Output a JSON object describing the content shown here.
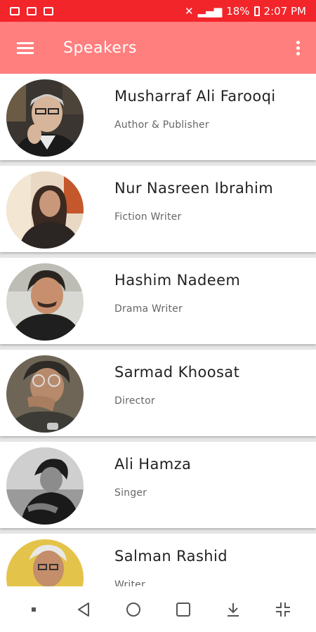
{
  "status_bar": {
    "battery": "18%",
    "time": "2:07 PM"
  },
  "app_bar": {
    "title": "Speakers",
    "menu_icon": "hamburger-menu-icon",
    "overflow_icon": "more-vert-icon"
  },
  "speakers": [
    {
      "name": "Musharraf Ali Farooqi",
      "role": "Author & Publisher"
    },
    {
      "name": "Nur Nasreen Ibrahim",
      "role": "Fiction Writer"
    },
    {
      "name": "Hashim Nadeem",
      "role": "Drama Writer"
    },
    {
      "name": "Sarmad Khoosat",
      "role": "Director"
    },
    {
      "name": "Ali Hamza",
      "role": "Singer"
    },
    {
      "name": "Salman Rashid",
      "role": "Writer"
    }
  ],
  "colors": {
    "status_bar": "#f2252a",
    "app_bar": "#ff7f7f",
    "background": "#e6e6e6"
  },
  "nav_icons": [
    "dot-icon",
    "back-icon",
    "home-icon",
    "recents-icon",
    "download-icon",
    "minimize-icon"
  ]
}
